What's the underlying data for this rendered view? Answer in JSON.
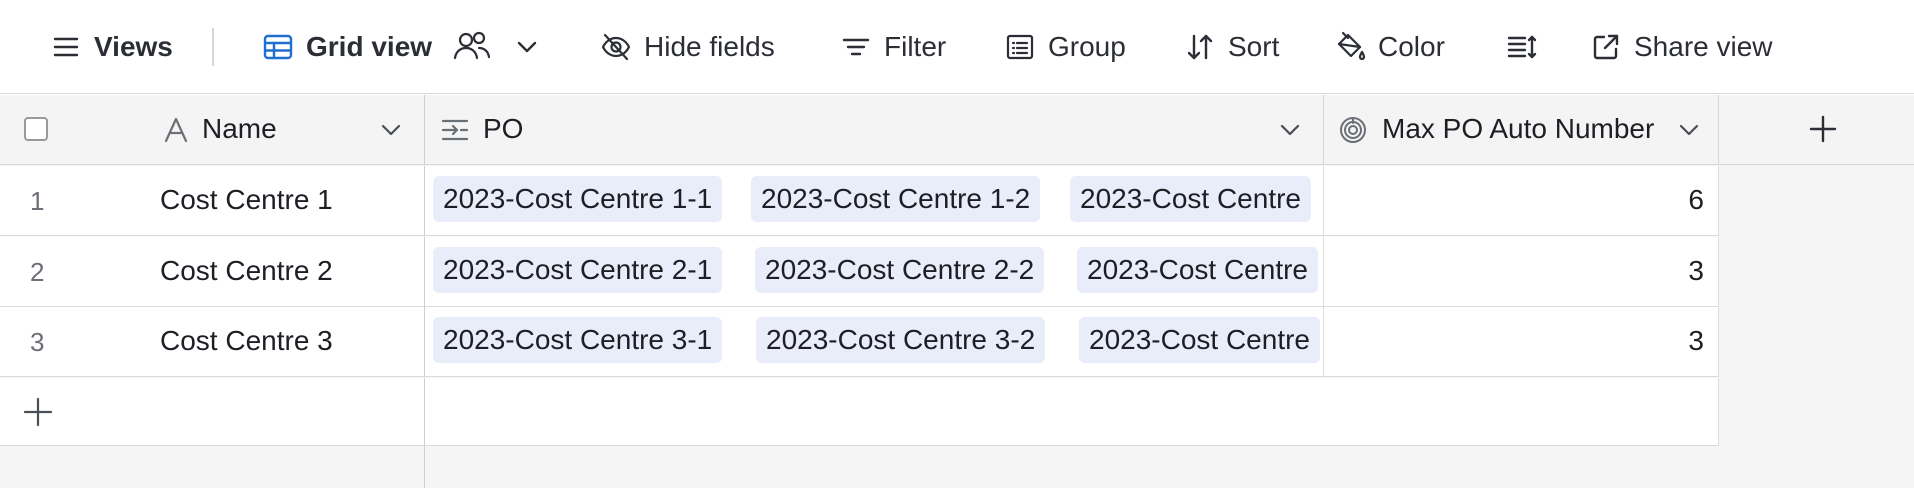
{
  "toolbar": {
    "views_label": "Views",
    "grid_view_label": "Grid view",
    "hide_fields_label": "Hide fields",
    "filter_label": "Filter",
    "group_label": "Group",
    "sort_label": "Sort",
    "color_label": "Color",
    "share_view_label": "Share view",
    "accent_color": "#1f6fd1"
  },
  "columns": {
    "name": "Name",
    "po": "PO",
    "max_po": "Max PO Auto Number"
  },
  "rows": [
    {
      "num": "1",
      "name": "Cost Centre 1",
      "po": [
        "2023-Cost Centre 1-1",
        "2023-Cost Centre 1-2",
        "2023-Cost Centre"
      ],
      "max": "6"
    },
    {
      "num": "2",
      "name": "Cost Centre 2",
      "po": [
        "2023-Cost Centre 2-1",
        "2023-Cost Centre 2-2",
        "2023-Cost Centre"
      ],
      "max": "3"
    },
    {
      "num": "3",
      "name": "Cost Centre 3",
      "po": [
        "2023-Cost Centre 3-1",
        "2023-Cost Centre 3-2",
        "2023-Cost Centre"
      ],
      "max": "3"
    }
  ],
  "chip_color": "#e9ecf9"
}
